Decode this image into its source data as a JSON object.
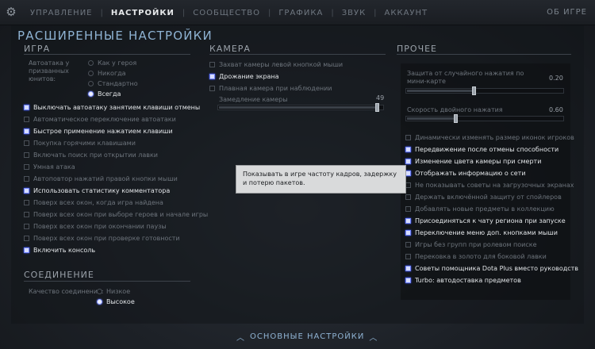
{
  "nav": {
    "tabs": [
      {
        "label": "УПРАВЛЕНИЕ"
      },
      {
        "label": "НАСТРОЙКИ"
      },
      {
        "label": "СООБЩЕСТВО"
      },
      {
        "label": "ГРАФИКА"
      },
      {
        "label": "ЗВУК"
      },
      {
        "label": "АККАУНТ"
      }
    ],
    "active_tab": "НАСТРОЙКИ",
    "about": "ОБ ИГРЕ"
  },
  "title": "РАСШИРЕННЫЕ НАСТРОЙКИ",
  "game": {
    "title": "ИГРА",
    "autoattack_label": "Автоатака у призванных юнитов:",
    "autoattack_options": [
      {
        "label": "Как у героя",
        "selected": false
      },
      {
        "label": "Никогда",
        "selected": false
      },
      {
        "label": "Стандартно",
        "selected": false
      },
      {
        "label": "Всегда",
        "selected": true
      }
    ],
    "options": [
      {
        "label": "Выключать автоатаку занятием клавиши отмены",
        "checked": true
      },
      {
        "label": "Автоматическое переключение автоатаки",
        "checked": false
      },
      {
        "label": "Быстрое применение нажатием клавиши",
        "checked": true
      },
      {
        "label": "Покупка горячими клавишами",
        "checked": false
      },
      {
        "label": "Включать поиск при открытии лавки",
        "checked": false
      },
      {
        "label": "Умная атака",
        "checked": false
      },
      {
        "label": "Автоповтор нажатий правой кнопки мыши",
        "checked": false
      },
      {
        "label": "Использовать статистику комментатора",
        "checked": true
      },
      {
        "label": "Поверх всех окон, когда игра найдена",
        "checked": false
      },
      {
        "label": "Поверх всех окон при выборе героев и начале игры",
        "checked": false
      },
      {
        "label": "Поверх всех окон при окончании паузы",
        "checked": false
      },
      {
        "label": "Поверх всех окон при проверке готовности",
        "checked": false
      },
      {
        "label": "Включить консоль",
        "checked": true
      }
    ]
  },
  "connection": {
    "title": "СОЕДИНЕНИЕ",
    "quality_label": "Качество соединения:",
    "options": [
      {
        "label": "Низкое",
        "selected": false
      },
      {
        "label": "Высокое",
        "selected": true
      }
    ]
  },
  "camera": {
    "title": "КАМЕРА",
    "options": [
      {
        "label": "Захват камеры левой кнопкой мыши",
        "checked": false
      },
      {
        "label": "Дрожание экрана",
        "checked": true
      },
      {
        "label": "Плавная камера при наблюдении",
        "checked": false
      }
    ],
    "slowdown_label": "Замедление камеры",
    "slowdown_value": "49",
    "slowdown_fraction": 0.98
  },
  "other": {
    "title": "ПРОЧЕЕ",
    "misclick_label": "Защита от случайного нажатия по мини-карте",
    "misclick_value": "0.20",
    "misclick_fraction": 0.43,
    "doubleclick_label": "Скорость двойного нажатия",
    "doubleclick_value": "0.60",
    "doubleclick_fraction": 0.31,
    "options": [
      {
        "label": "Динамически изменять размер иконок игроков",
        "checked": false
      },
      {
        "label": "Передвижение после отмены способности",
        "checked": true
      },
      {
        "label": "Изменение цвета камеры при смерти",
        "checked": true
      },
      {
        "label": "Отображать информацию о сети",
        "checked": true
      },
      {
        "label": "Не показывать советы на загрузочных экранах",
        "checked": false
      },
      {
        "label": "Держать включённой защиту от спойлеров",
        "checked": false
      },
      {
        "label": "Добавлять новые предметы в коллекцию",
        "checked": false
      },
      {
        "label": "Присоединяться к чату региона при запуске",
        "checked": true
      },
      {
        "label": "Переключение меню доп. кнопками мыши",
        "checked": true
      },
      {
        "label": "Игры без групп при ролевом поиске",
        "checked": false
      },
      {
        "label": "Перековка в золото для боковой лавки",
        "checked": false
      },
      {
        "label": "Советы помощника Dota Plus вместо руководств",
        "checked": true
      },
      {
        "label": "Turbo: автодоставка предметов",
        "checked": true
      }
    ]
  },
  "tooltip": {
    "text": "Показывать в игре частоту кадров, задержку и потерю пакетов."
  },
  "footer": {
    "label": "ОСНОВНЫЕ НАСТРОЙКИ"
  }
}
